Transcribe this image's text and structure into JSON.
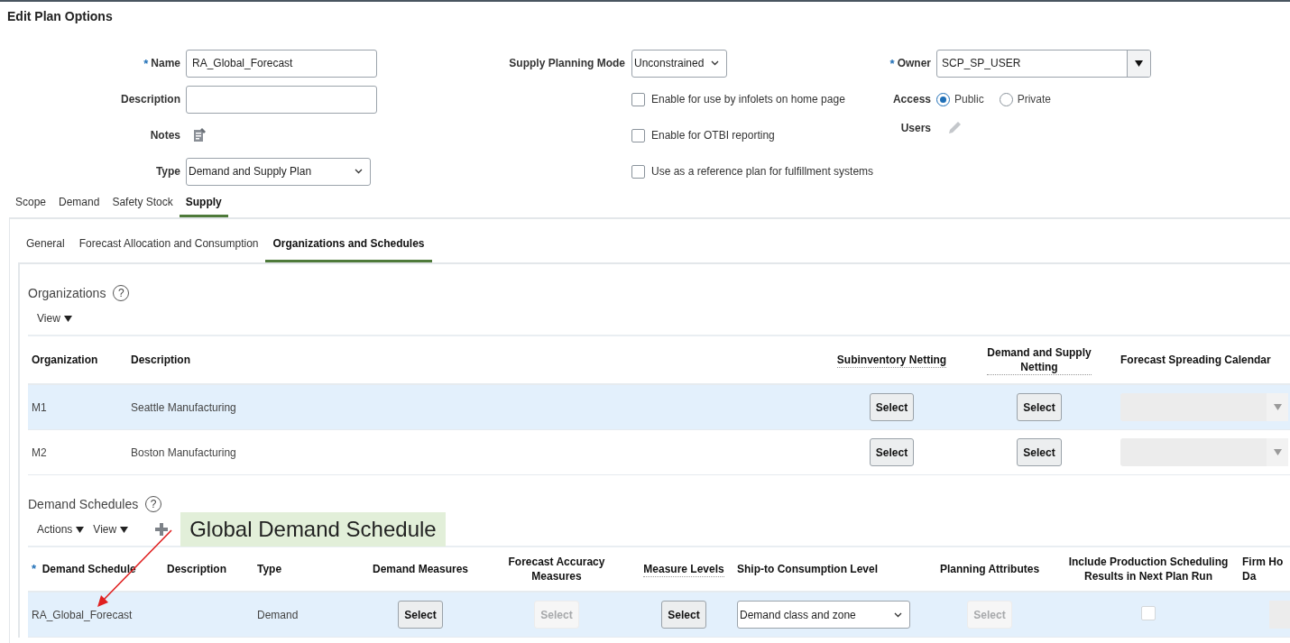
{
  "title": "Edit Plan Options",
  "form": {
    "name": {
      "label": "Name",
      "required": "*",
      "value": "RA_Global_Forecast"
    },
    "description": {
      "label": "Description"
    },
    "notes": {
      "label": "Notes"
    },
    "type": {
      "label": "Type",
      "value": "Demand and Supply Plan"
    },
    "supply_planning_mode": {
      "label": "Supply Planning Mode",
      "value": "Unconstrained"
    },
    "options": [
      {
        "label": "Enable for use by infolets on home page",
        "checked": false
      },
      {
        "label": "Enable for OTBI reporting",
        "checked": false
      },
      {
        "label": "Use as a reference plan for fulfillment systems",
        "checked": false
      }
    ],
    "owner": {
      "label": "Owner",
      "required": "*",
      "value": "SCP_SP_USER"
    },
    "access": {
      "label": "Access",
      "options": [
        {
          "label": "Public",
          "selected": true
        },
        {
          "label": "Private",
          "selected": false
        }
      ]
    },
    "users": {
      "label": "Users"
    }
  },
  "tabs": [
    {
      "label": "Scope",
      "selected": false
    },
    {
      "label": "Demand",
      "selected": false
    },
    {
      "label": "Safety Stock",
      "selected": false
    },
    {
      "label": "Supply",
      "selected": true
    }
  ],
  "subtabs": [
    {
      "label": "General",
      "selected": false
    },
    {
      "label": "Forecast Allocation and Consumption",
      "selected": false
    },
    {
      "label": "Organizations and Schedules",
      "selected": true
    }
  ],
  "organizations": {
    "title": "Organizations",
    "help": "?",
    "toolbar": [
      {
        "label": "View"
      }
    ],
    "columns": [
      {
        "label": "Organization",
        "tooltip": false
      },
      {
        "label": "Description",
        "tooltip": false
      },
      {
        "label": "Subinventory Netting",
        "tooltip": true
      },
      {
        "label": "Demand and Supply\nNetting",
        "tooltip": true
      },
      {
        "label": "Forecast Spreading Calendar",
        "tooltip": false
      }
    ],
    "rows": [
      {
        "selected": true,
        "cells": [
          {
            "kind": "text",
            "text": "M1"
          },
          {
            "kind": "text",
            "text": "Seattle Manufacturing"
          },
          {
            "kind": "button",
            "text": "Select",
            "disabled": false
          },
          {
            "kind": "button",
            "text": "Select",
            "disabled": false
          },
          {
            "kind": "select",
            "disabled": true
          }
        ]
      },
      {
        "selected": false,
        "cells": [
          {
            "kind": "text",
            "text": "M2"
          },
          {
            "kind": "text",
            "text": "Boston Manufacturing"
          },
          {
            "kind": "button",
            "text": "Select",
            "disabled": false
          },
          {
            "kind": "button",
            "text": "Select",
            "disabled": false
          },
          {
            "kind": "select",
            "disabled": true
          }
        ]
      }
    ]
  },
  "demand_schedules": {
    "title": "Demand Schedules",
    "help": "?",
    "toolbar": [
      {
        "label": "Actions"
      },
      {
        "label": "View"
      }
    ],
    "callout": "Global Demand Schedule",
    "columns": [
      {
        "label": "Demand Schedule",
        "required": "*",
        "tooltip": false
      },
      {
        "label": "Description",
        "tooltip": false
      },
      {
        "label": "Type",
        "tooltip": false
      },
      {
        "label": "Demand Measures",
        "tooltip": false
      },
      {
        "label": "Forecast Accuracy\nMeasures",
        "tooltip": false
      },
      {
        "label": "Measure Levels",
        "tooltip": true
      },
      {
        "label": "Ship-to Consumption Level",
        "tooltip": false
      },
      {
        "label": "Planning Attributes",
        "tooltip": false
      },
      {
        "label": "Include Production Scheduling\nResults in Next Plan Run",
        "tooltip": false
      },
      {
        "label": "Firm Ho\nDa",
        "tooltip": false
      }
    ],
    "rows": [
      {
        "selected": true,
        "cells": [
          {
            "kind": "text",
            "text": "RA_Global_Forecast"
          },
          {
            "kind": "empty"
          },
          {
            "kind": "text",
            "text": "Demand"
          },
          {
            "kind": "button",
            "text": "Select",
            "disabled": false
          },
          {
            "kind": "button",
            "text": "Select",
            "disabled": true
          },
          {
            "kind": "button",
            "text": "Select",
            "disabled": false
          },
          {
            "kind": "select",
            "value": "Demand class and zone",
            "disabled": false
          },
          {
            "kind": "button",
            "text": "Select",
            "disabled": true
          },
          {
            "kind": "checkbox",
            "checked": false,
            "disabled": true
          },
          {
            "kind": "field",
            "disabled": true
          }
        ]
      }
    ]
  }
}
